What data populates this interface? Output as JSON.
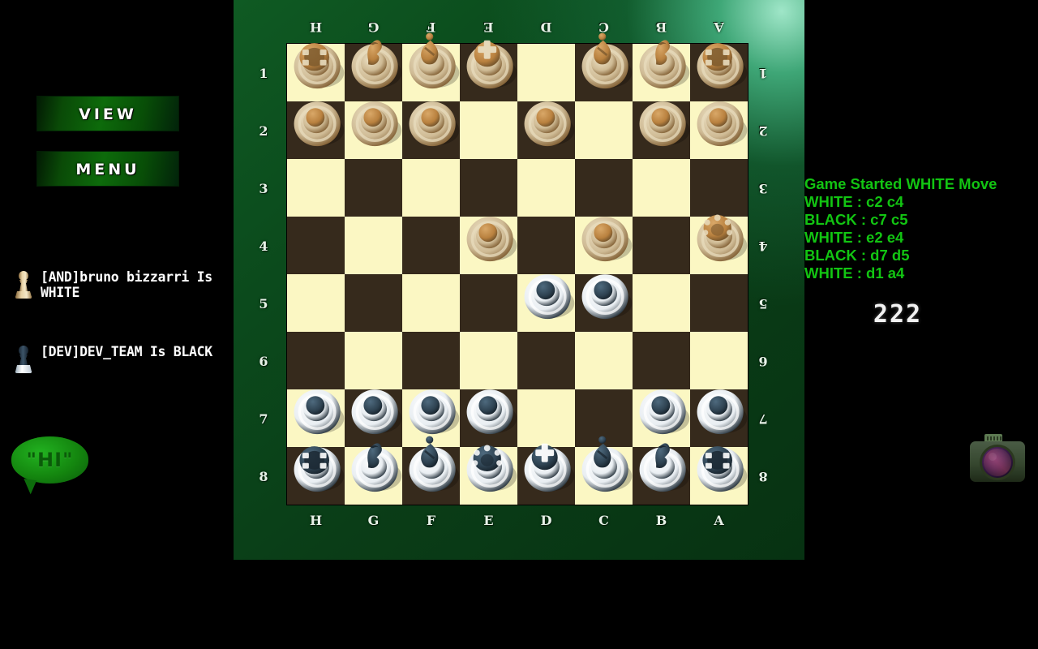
{
  "sidebar": {
    "view_label": "VIEW",
    "menu_label": "MENU",
    "chat_bubble_text": "\"HI\"",
    "players": [
      {
        "name": "[AND]bruno bizzarri Is WHITE",
        "icon": "white-pawn-icon",
        "side": "WHITE"
      },
      {
        "name": "[DEV]DEV_TEAM Is BLACK",
        "icon": "black-pawn-icon",
        "side": "BLACK"
      }
    ]
  },
  "board": {
    "files_top": [
      "H",
      "G",
      "F",
      "E",
      "D",
      "C",
      "B",
      "A"
    ],
    "files_bottom": [
      "H",
      "G",
      "F",
      "E",
      "D",
      "C",
      "B",
      "A"
    ],
    "ranks_left": [
      "1",
      "2",
      "3",
      "4",
      "5",
      "6",
      "7",
      "8"
    ],
    "ranks_right": [
      "1",
      "2",
      "3",
      "4",
      "5",
      "6",
      "7",
      "8"
    ],
    "light_square_color": "#fbf7c3",
    "dark_square_color": "#362a1c",
    "frame_color": "#0a3d17",
    "highlight_color": "#9fe6c8",
    "orientation": "black-perspective",
    "pieces": [
      {
        "type": "rook",
        "color": "white",
        "col": 0,
        "row": 0
      },
      {
        "type": "knight",
        "color": "white",
        "col": 1,
        "row": 0
      },
      {
        "type": "bishop",
        "color": "white",
        "col": 2,
        "row": 0
      },
      {
        "type": "king",
        "color": "white",
        "col": 3,
        "row": 0
      },
      {
        "type": "bishop",
        "color": "white",
        "col": 5,
        "row": 0
      },
      {
        "type": "knight",
        "color": "white",
        "col": 6,
        "row": 0
      },
      {
        "type": "rook",
        "color": "white",
        "col": 7,
        "row": 0
      },
      {
        "type": "pawn",
        "color": "white",
        "col": 0,
        "row": 1
      },
      {
        "type": "pawn",
        "color": "white",
        "col": 1,
        "row": 1
      },
      {
        "type": "pawn",
        "color": "white",
        "col": 2,
        "row": 1
      },
      {
        "type": "pawn",
        "color": "white",
        "col": 4,
        "row": 1
      },
      {
        "type": "pawn",
        "color": "white",
        "col": 6,
        "row": 1
      },
      {
        "type": "pawn",
        "color": "white",
        "col": 7,
        "row": 1
      },
      {
        "type": "pawn",
        "color": "white",
        "col": 3,
        "row": 3
      },
      {
        "type": "pawn",
        "color": "white",
        "col": 5,
        "row": 3
      },
      {
        "type": "queen",
        "color": "white",
        "col": 7,
        "row": 3
      },
      {
        "type": "pawn",
        "color": "black",
        "col": 4,
        "row": 4
      },
      {
        "type": "pawn",
        "color": "black",
        "col": 5,
        "row": 4
      },
      {
        "type": "pawn",
        "color": "black",
        "col": 0,
        "row": 6
      },
      {
        "type": "pawn",
        "color": "black",
        "col": 1,
        "row": 6
      },
      {
        "type": "pawn",
        "color": "black",
        "col": 2,
        "row": 6
      },
      {
        "type": "pawn",
        "color": "black",
        "col": 3,
        "row": 6
      },
      {
        "type": "pawn",
        "color": "black",
        "col": 6,
        "row": 6
      },
      {
        "type": "pawn",
        "color": "black",
        "col": 7,
        "row": 6
      },
      {
        "type": "rook",
        "color": "black",
        "col": 0,
        "row": 7
      },
      {
        "type": "knight",
        "color": "black",
        "col": 1,
        "row": 7
      },
      {
        "type": "bishop",
        "color": "black",
        "col": 2,
        "row": 7
      },
      {
        "type": "queen",
        "color": "black",
        "col": 3,
        "row": 7
      },
      {
        "type": "king",
        "color": "black",
        "col": 4,
        "row": 7
      },
      {
        "type": "bishop",
        "color": "black",
        "col": 5,
        "row": 7
      },
      {
        "type": "knight",
        "color": "black",
        "col": 6,
        "row": 7
      },
      {
        "type": "rook",
        "color": "black",
        "col": 7,
        "row": 7
      }
    ]
  },
  "log": {
    "color": "#12c412",
    "lines": [
      "Game Started WHITE Move",
      "WHITE : c2 c4",
      "BLACK : c7 c5",
      "WHITE : e2 e4",
      "BLACK : d7 d5",
      "WHITE : d1 a4"
    ],
    "counter": "222"
  },
  "camera": {
    "icon": "camera-icon"
  }
}
